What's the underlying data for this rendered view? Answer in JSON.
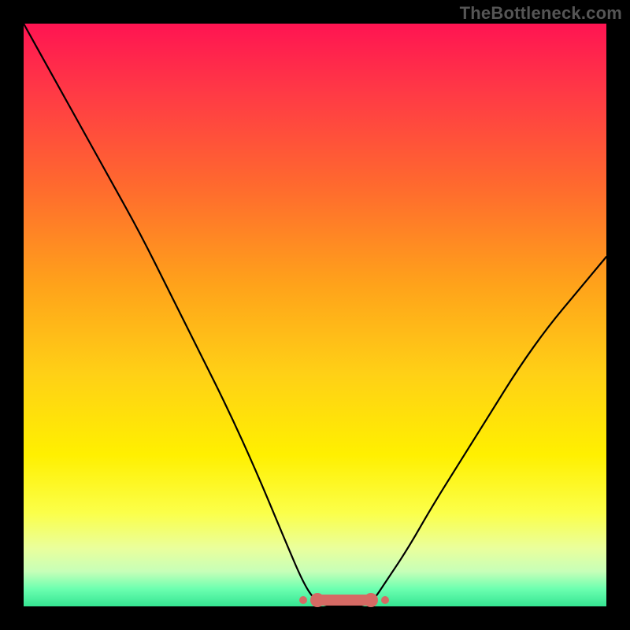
{
  "attribution": "TheBottleneck.com",
  "chart_data": {
    "type": "line",
    "title": "",
    "xlabel": "",
    "ylabel": "",
    "xlim": [
      0,
      100
    ],
    "ylim": [
      0,
      100
    ],
    "background_gradient": {
      "top_color": "#ff1452",
      "bottom_color": "#35e592",
      "meaning": "high-to-low (red=high bottleneck, green=low)"
    },
    "series": [
      {
        "name": "curve",
        "x": [
          0,
          5,
          10,
          15,
          20,
          25,
          30,
          35,
          40,
          45,
          48,
          50,
          52,
          55,
          58,
          60,
          62,
          66,
          70,
          75,
          80,
          85,
          90,
          95,
          100
        ],
        "y": [
          100,
          91,
          82,
          73,
          64,
          54,
          44,
          34,
          23,
          11,
          4,
          1,
          0,
          0,
          0,
          1,
          4,
          10,
          17,
          25,
          33,
          41,
          48,
          54,
          60
        ]
      }
    ],
    "flat_region": {
      "x_start": 50,
      "x_end": 60,
      "y": 0
    },
    "annotations": []
  },
  "colors": {
    "frame": "#000000",
    "attribution_text": "#555555",
    "curve_stroke": "#000000",
    "baseline_highlight": "#d56a64"
  }
}
